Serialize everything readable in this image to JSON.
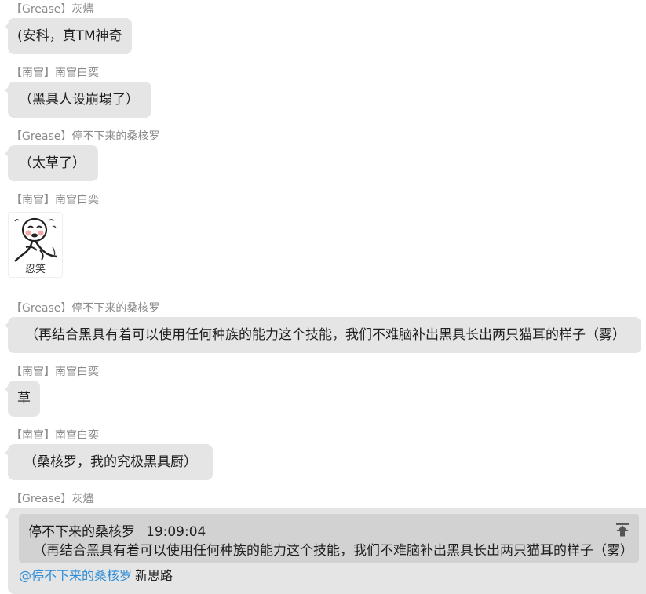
{
  "messages": [
    {
      "sender": "【Grease】灰燼",
      "text": "(安科，真TM神奇"
    },
    {
      "sender": "【南宫】南宫白奕",
      "text": "（黑具人设崩塌了）"
    },
    {
      "sender": "【Grease】停不下来的桑核罗",
      "text": "（太草了）"
    },
    {
      "sender": "【南宫】南宫白奕",
      "sticker_caption": "忍笑"
    },
    {
      "sender": "【Grease】停不下来的桑核罗",
      "text": "（再结合黑具有着可以使用任何种族的能力这个技能，我们不难脑补出黑具长出两只猫耳的样子（雾）"
    },
    {
      "sender": "【南宫】南宫白奕",
      "text": "草"
    },
    {
      "sender": "【南宫】南宫白奕",
      "text": "（桑核罗，我的究极黑具厨）"
    },
    {
      "sender": "【Grease】灰燼",
      "quote": {
        "author": "停不下来的桑核罗",
        "time": "19:09:04",
        "text": "（再结合黑具有着可以使用任何种族的能力这个技能，我们不难脑补出黑具长出两只猫耳的样子（雾）"
      },
      "mention": "@停不下来的桑核罗",
      "text": "新思路"
    }
  ],
  "icons": {
    "sticker": "laughing-stickman-sticker",
    "jump": "jump-to-original-icon"
  },
  "colors": {
    "bubble": "#e5e5e5",
    "quote": "#d2d2d2",
    "sender": "#8a8a8a",
    "mention": "#2e8ed8"
  }
}
